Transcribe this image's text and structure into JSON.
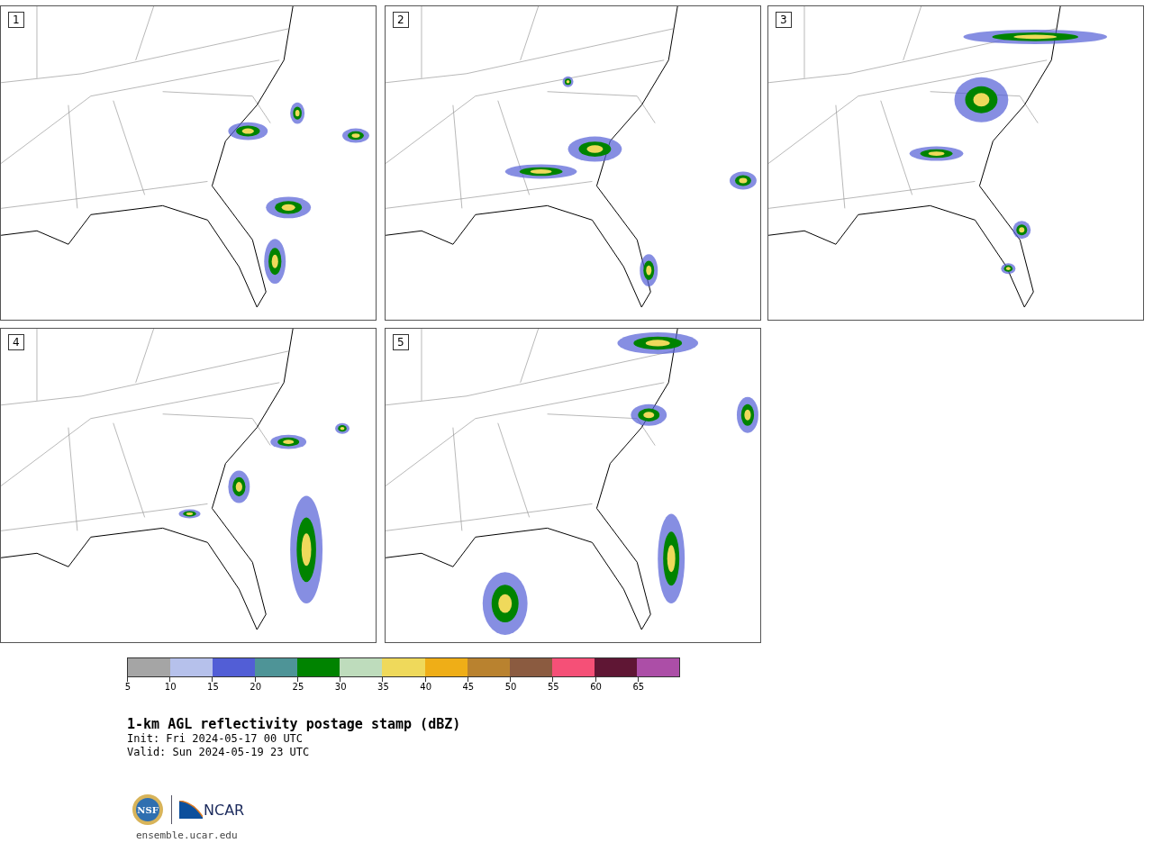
{
  "panels": [
    {
      "label": "1"
    },
    {
      "label": "2"
    },
    {
      "label": "3"
    },
    {
      "label": "4"
    },
    {
      "label": "5"
    }
  ],
  "colorbar": {
    "segments": [
      {
        "color": "#a5a5a5"
      },
      {
        "color": "#b6c1eb"
      },
      {
        "color": "#525ed6"
      },
      {
        "color": "#4e9497"
      },
      {
        "color": "#008300"
      },
      {
        "color": "#bedcbc"
      },
      {
        "color": "#efd95b"
      },
      {
        "color": "#efae17"
      },
      {
        "color": "#b9822f"
      },
      {
        "color": "#8b5b40"
      },
      {
        "color": "#f55077"
      },
      {
        "color": "#5f1634"
      },
      {
        "color": "#ac4ea7"
      }
    ],
    "ticks": [
      "5",
      "10",
      "15",
      "20",
      "25",
      "30",
      "35",
      "40",
      "45",
      "50",
      "55",
      "60",
      "65"
    ]
  },
  "title": "1-km AGL reflectivity postage stamp (dBZ)",
  "init": " Init: Fri 2024-05-17 00 UTC",
  "valid": "Valid: Sun 2024-05-19 23 UTC",
  "footer": {
    "url": "ensemble.ucar.edu",
    "ncar_logo_text": "NCAR",
    "nsf_logo_text": "NSF"
  }
}
